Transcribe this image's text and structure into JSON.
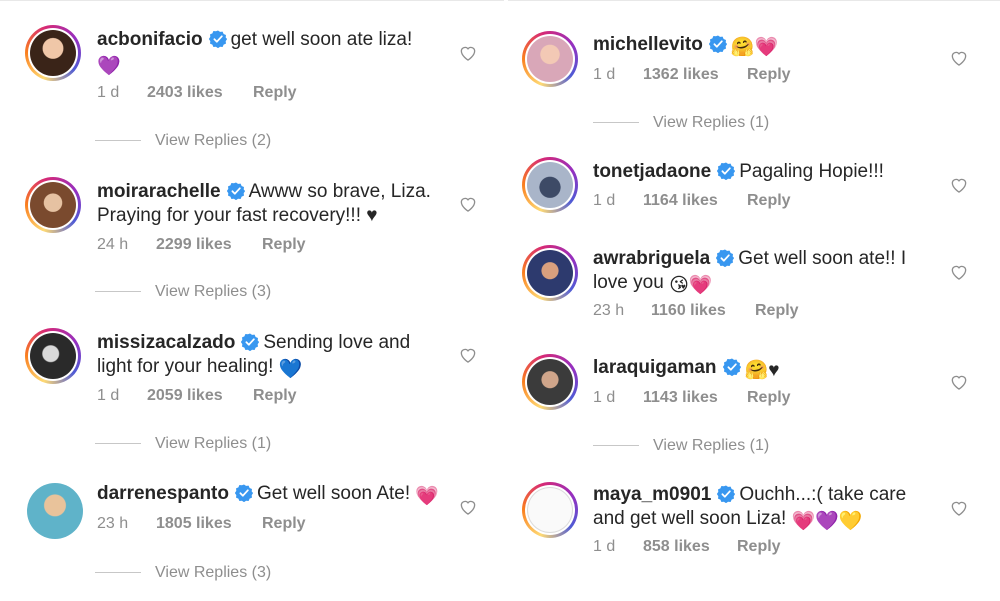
{
  "left_column": [
    {
      "username": "acbonifacio",
      "text": "get well soon ate liza!",
      "emoji": "💜",
      "time": "1 d",
      "likes": "2403 likes",
      "reply": "Reply",
      "view_replies": "View Replies (2)"
    },
    {
      "username": "moirarachelle",
      "text": "Awww so brave, Liza.",
      "text_line2": "Praying for your fast recovery!!! ♥",
      "time": "24 h",
      "likes": "2299 likes",
      "reply": "Reply",
      "view_replies": "View Replies (3)"
    },
    {
      "username": "missizacalzado",
      "text": "Sending love and",
      "text_line2": "light for your healing!",
      "emoji": "💙",
      "time": "1 d",
      "likes": "2059 likes",
      "reply": "Reply",
      "view_replies": "View Replies (1)"
    },
    {
      "username": "darrenespanto",
      "text": "Get well soon Ate!",
      "emoji": "💗",
      "time": "23 h",
      "likes": "1805 likes",
      "reply": "Reply",
      "view_replies": "View Replies (3)"
    }
  ],
  "right_column": [
    {
      "username": "michellevito",
      "emoji": "🤗💗",
      "time": "1 d",
      "likes": "1362 likes",
      "reply": "Reply",
      "view_replies": "View Replies (1)"
    },
    {
      "username": "tonetjadaone",
      "text": "Pagaling Hopie!!!",
      "time": "1 d",
      "likes": "1164 likes",
      "reply": "Reply"
    },
    {
      "username": "awrabriguela",
      "text": "Get well soon ate!! I",
      "text_line2": "love you",
      "emoji": "😘💗",
      "time": "23 h",
      "likes": "1160 likes",
      "reply": "Reply"
    },
    {
      "username": "laraquigaman",
      "emoji": "🤗♥",
      "time": "1 d",
      "likes": "1143 likes",
      "reply": "Reply",
      "view_replies": "View Replies (1)"
    },
    {
      "username": "maya_m0901",
      "text": "Ouchh...:( take care",
      "text_line2": "and get well soon Liza!",
      "emoji": "💗💜💛",
      "time": "1 d",
      "likes": "858 likes",
      "reply": "Reply"
    }
  ],
  "colors": {
    "verified_badge": "#3897f0",
    "meta_text": "#8e8e8e",
    "username_text": "#262626"
  }
}
